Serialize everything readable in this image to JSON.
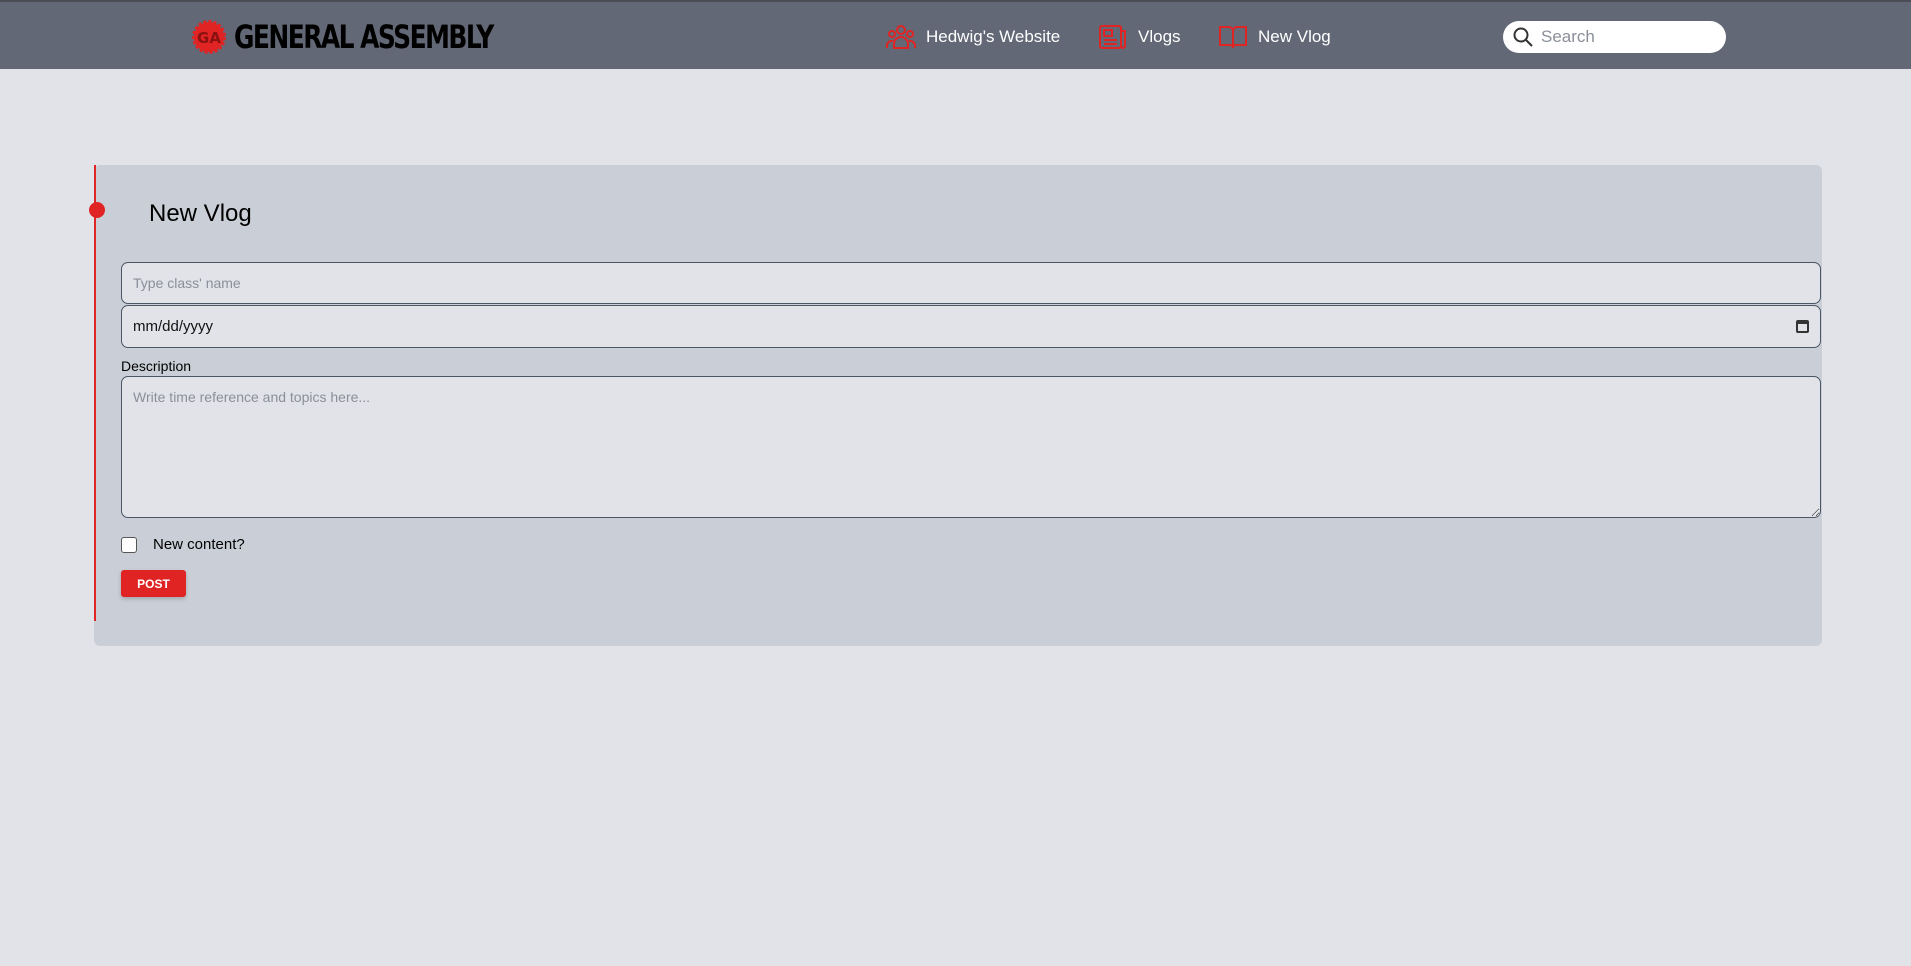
{
  "navbar": {
    "brand": "GENERAL ASSEMBLY",
    "brand_mark": "GA",
    "items": [
      {
        "label": "Hedwig's Website",
        "icon": "users-icon"
      },
      {
        "label": "Vlogs",
        "icon": "newspaper-icon"
      },
      {
        "label": "New Vlog",
        "icon": "book-open-icon"
      }
    ],
    "search_placeholder": "Search"
  },
  "form": {
    "title": "New Vlog",
    "class_name_placeholder": "Type class' name",
    "date_placeholder": "mm/dd/yyyy",
    "description_label": "Description",
    "description_placeholder": "Write time reference and topics here...",
    "new_content_label": "New content?",
    "new_content_checked": false,
    "post_label": "POST"
  },
  "colors": {
    "accent": "#e02424",
    "navbar": "#636876",
    "card": "#cacfd7",
    "background": "#e1e3e8"
  }
}
